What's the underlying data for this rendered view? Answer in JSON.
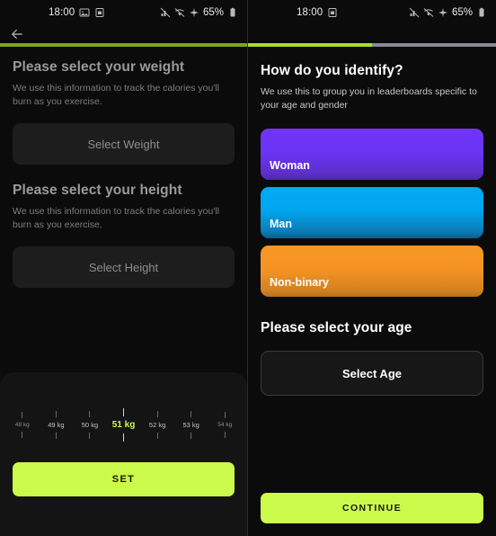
{
  "colors": {
    "accent_lime": "#ccfa4b",
    "progress_track": "#8a8a96",
    "progress_dim": "#3b4a13",
    "screen_bg": "#0b0b0b",
    "panel_bg": "#141414",
    "card_woman": "#6a33f4",
    "card_man": "#00a6ef",
    "card_nonbinary": "#f49324"
  },
  "left": {
    "statusbar": {
      "time": "18:00",
      "left_icons": [
        "image-icon",
        "sim-card-icon"
      ],
      "right_icons": [
        "signal-off-icon",
        "wifi-off-icon",
        "airplane-mode-icon"
      ],
      "battery_percent": "65%",
      "battery_icon": "battery-icon"
    },
    "back_icon": "back-arrow-icon",
    "progress_percent": 100,
    "weight": {
      "title": "Please select your weight",
      "subtitle": "We use this information to track the calories you'll burn as you exercise.",
      "button_label": "Select Weight"
    },
    "height": {
      "title": "Please select your height",
      "subtitle": "We use this information to track the calories you'll burn as you exercise.",
      "button_label": "Select Height"
    },
    "ruler": {
      "selected_value": "51 kg",
      "ticks": [
        {
          "label": "48 kg",
          "selected": false,
          "edge": true
        },
        {
          "label": "49 kg",
          "selected": false,
          "edge": false
        },
        {
          "label": "50 kg",
          "selected": false,
          "edge": false
        },
        {
          "label": "51 kg",
          "selected": true,
          "edge": false
        },
        {
          "label": "52 kg",
          "selected": false,
          "edge": false
        },
        {
          "label": "53 kg",
          "selected": false,
          "edge": false
        },
        {
          "label": "54 kg",
          "selected": false,
          "edge": true
        }
      ]
    },
    "cta_label": "SET"
  },
  "right": {
    "statusbar": {
      "time": "18:00",
      "left_icons": [
        "sim-card-icon"
      ],
      "right_icons": [
        "signal-off-icon",
        "wifi-off-icon",
        "airplane-mode-icon"
      ],
      "battery_percent": "65%",
      "battery_icon": "battery-icon"
    },
    "progress_percent": 50,
    "identify": {
      "title": "How do you identify?",
      "subtitle": "We use this to group you in leaderboards specific to your age and gender",
      "options": [
        {
          "label": "Woman"
        },
        {
          "label": "Man"
        },
        {
          "label": "Non-binary"
        }
      ]
    },
    "age": {
      "title": "Please select your age",
      "button_label": "Select Age"
    },
    "cta_label": "CONTINUE"
  }
}
